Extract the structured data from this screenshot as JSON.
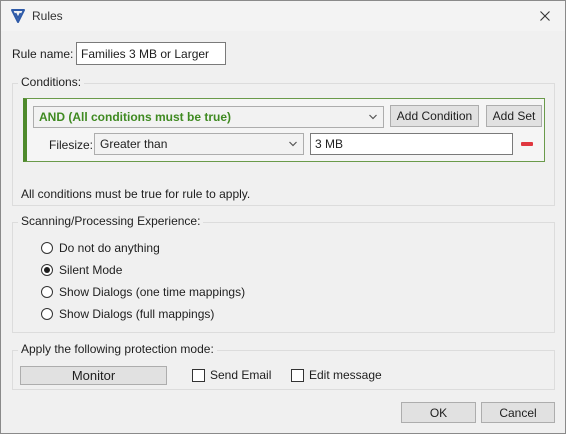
{
  "window": {
    "title": "Rules",
    "close_symbol": "✕"
  },
  "rule_name": {
    "label": "Rule name:",
    "value": "Families 3 MB or Larger"
  },
  "conditions": {
    "group_label": "Conditions:",
    "logic_combo": "AND (All conditions must be true)",
    "add_condition_label": "Add Condition",
    "add_set_label": "Add Set",
    "row": {
      "field_label": "Filesize:",
      "operator": "Greater than",
      "value": "3 MB"
    },
    "summary": "All conditions must be true for rule to apply."
  },
  "scanning": {
    "group_label": "Scanning/Processing Experience:",
    "options": [
      {
        "label": "Do not do anything",
        "checked": false
      },
      {
        "label": "Silent Mode",
        "checked": true
      },
      {
        "label": "Show Dialogs (one time mappings)",
        "checked": false
      },
      {
        "label": "Show Dialogs (full mappings)",
        "checked": false
      }
    ]
  },
  "protection": {
    "group_label": "Apply the following protection mode:",
    "mode_button": "Monitor",
    "send_email_label": "Send Email",
    "edit_message_label": "Edit message"
  },
  "footer": {
    "ok_label": "OK",
    "cancel_label": "Cancel"
  },
  "colors": {
    "condition_accent": "#4e8a2c",
    "logic_text": "#3f8a21",
    "remove": "#e0373f"
  },
  "icons": {
    "app": "shield-v-icon",
    "close": "close-icon",
    "dropdown": "chevron-down-icon",
    "remove": "minus-icon"
  }
}
